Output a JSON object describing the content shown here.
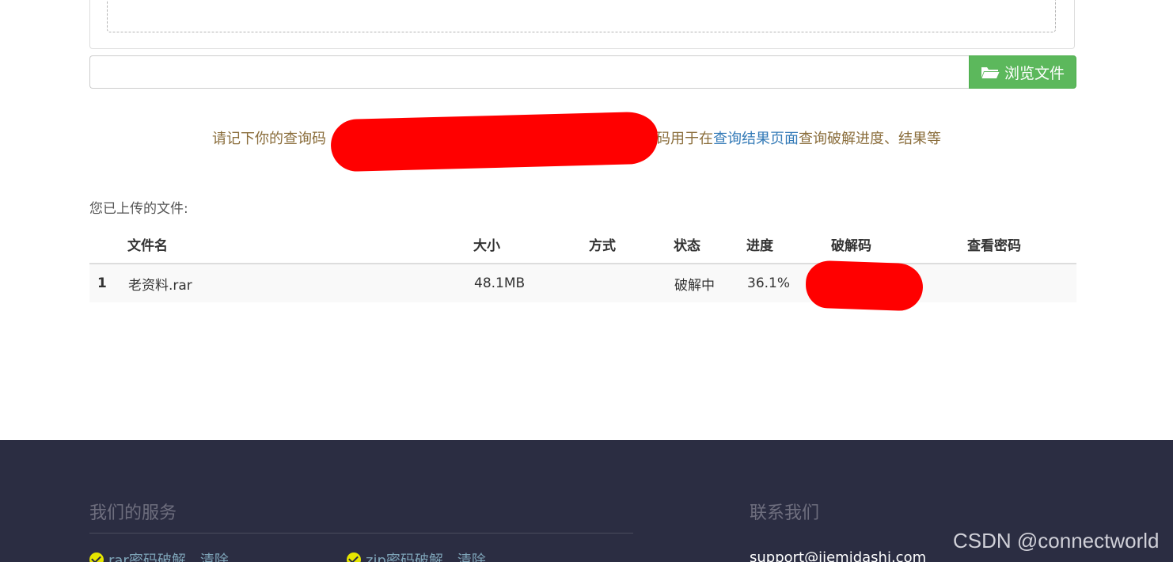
{
  "upload": {
    "browse_label": "浏览文件",
    "file_input_value": ""
  },
  "notice": {
    "prefix": "请记下你的查询码",
    "middle": "码用于在",
    "link": "查询结果页面",
    "suffix": "查询破解进度、结果等"
  },
  "uploaded_label": "您已上传的文件:",
  "table": {
    "headers": [
      "",
      "文件名",
      "大小",
      "方式",
      "状态",
      "进度",
      "破解码",
      "查看密码"
    ],
    "rows": [
      {
        "index": "1",
        "name": "老资料.rar",
        "size": "48.1MB",
        "method": "",
        "status": "破解中",
        "progress": "36.1%",
        "code": "",
        "view": ""
      }
    ]
  },
  "footer": {
    "services_title": "我们的服务",
    "contact_title": "联系我们",
    "services": [
      {
        "label": "rar密码破解",
        "clear": "清除"
      },
      {
        "label": "zip密码破解",
        "clear": "清除"
      }
    ],
    "email": "support@jiemidashi.com",
    "watermark": "CSDN @connectworld"
  },
  "colors": {
    "button_green": "#5cb85c",
    "notice_text": "#8a6d3b",
    "link_blue": "#337ab7",
    "footer_bg": "#2b2d42",
    "redaction": "#ff0000"
  },
  "icons": {
    "browse": "folder-open-icon",
    "service_check": "check-circle-icon"
  }
}
